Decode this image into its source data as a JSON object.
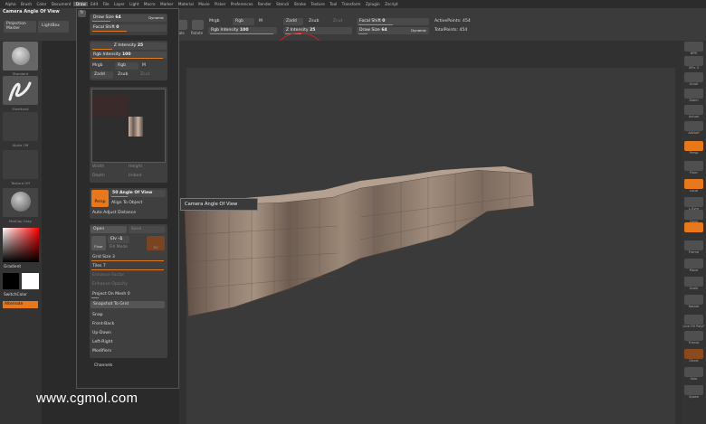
{
  "menu": [
    "Alpha",
    "Brush",
    "Color",
    "Document",
    "Draw",
    "Edit",
    "File",
    "Layer",
    "Light",
    "Macro",
    "Marker",
    "Material",
    "Movie",
    "Picker",
    "Preferences",
    "Render",
    "Stencil",
    "Stroke",
    "Texture",
    "Tool",
    "Transform",
    "Zplugin",
    "Zscript"
  ],
  "menu_active": "Draw",
  "window_title": "Camera Angle Of View",
  "top": {
    "projection_master": "Projection\nMaster",
    "lightbox": "LightBox",
    "scale_label": "Scale",
    "rotate_label": "Rotate",
    "mrgb": "Mrgb",
    "rgb": "Rgb",
    "m": "M",
    "rgb_intensity_label": "Rgb Intensity",
    "rgb_intensity_value": "100",
    "zadd": "Zadd",
    "zsub": "Zsub",
    "zcut": "Zcut",
    "z_intensity_label": "Z Intensity",
    "z_intensity_value": "25",
    "focal_shift_label": "Focal Shift",
    "focal_shift_value": "0",
    "draw_size_label": "Draw Size",
    "draw_size_value": "64",
    "dynamic": "Dynamic",
    "active_points": "ActivePoints: 454",
    "total_points": "TotalPoints: 454"
  },
  "left": {
    "brush_label": "Standard",
    "stroke_label": "FreeHand",
    "alpha_label": "Alpha Off",
    "texture_label": "Texture Off",
    "material_label": "MatCap Gray",
    "gradient": "Gradient",
    "switch_color": "SwitchColor",
    "alternate": "Alternate"
  },
  "draw": {
    "draw_size_label": "Draw Size",
    "draw_size_value": "64",
    "dynamic": "Dynamic",
    "focal_shift_label": "Focal Shift",
    "focal_shift_value": "0",
    "z_intensity_label": "Z Intensity",
    "z_intensity_value": "25",
    "rgb_intensity_label": "Rgb Intensity",
    "rgb_intensity_value": "100",
    "mrgb": "Mrgb",
    "rgb": "Rgb",
    "m": "M",
    "zadd": "Zadd",
    "zsub": "Zsub",
    "zcut": "Zcut",
    "width": "Width",
    "height": "Height",
    "depth": "Depth",
    "imbed": "Imbed",
    "persp": "Persp",
    "angle_label": "50 Angle Of View",
    "align": "Align To Object",
    "auto_adjust": "Auto Adjust Distance",
    "open": "Open",
    "save": "Save",
    "floor": "Floor",
    "elv_label": "Elv",
    "elv_value": "-1",
    "fill_mode": "Fill Mode",
    "fill_value": "Fill",
    "grid_size": "Grid Size 3",
    "tiles": "Tiles 7",
    "enhance_factor": "Enhance Factor",
    "enhance_opacity": "Enhance Opacity",
    "project_on_mesh": "Project On Mesh 0",
    "snapshot": "Snapshot To Grid",
    "snap": "Snap",
    "front_back": "Front-Back",
    "up_down": "Up-Down",
    "left_right": "Left-Right",
    "modifiers": "Modifiers",
    "channels": "Channels"
  },
  "right": [
    "BPR",
    "SPix 3",
    "Scroll",
    "Zoom",
    "Actual",
    "AAHalf",
    "Persp",
    "Floor",
    "Local",
    "L.Sym",
    "Qxyz",
    "",
    "Frame",
    "Move",
    "Scale",
    "Rotate",
    "Line Fill PolyF",
    "Transp",
    "Ghost",
    "Solo",
    "Xpose"
  ],
  "tooltip": "Camera Angle Of View",
  "watermark": "www.cgmol.com",
  "colors": {
    "accent": "#e8781c",
    "panel": "#3f3f3f",
    "bg": "#2a2a2a"
  }
}
